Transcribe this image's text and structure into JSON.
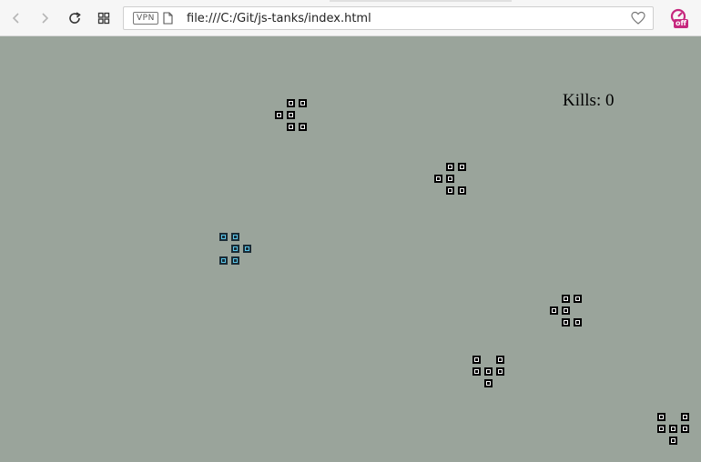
{
  "browser": {
    "url": "file:///C:/Git/js-tanks/index.html",
    "vpn_label": "VPN",
    "extension_badge": "off"
  },
  "game": {
    "kills_label": "Kills: 0",
    "colors": {
      "background": "#9aa49b",
      "player": "#5bc7ea",
      "enemy": "#000000"
    },
    "tanks": [
      {
        "team": "player",
        "facing": "right"
      },
      {
        "team": "enemy",
        "facing": "left"
      },
      {
        "team": "enemy",
        "facing": "left"
      },
      {
        "team": "enemy",
        "facing": "left"
      },
      {
        "team": "enemy",
        "facing": "down"
      },
      {
        "team": "enemy",
        "facing": "down"
      }
    ]
  }
}
